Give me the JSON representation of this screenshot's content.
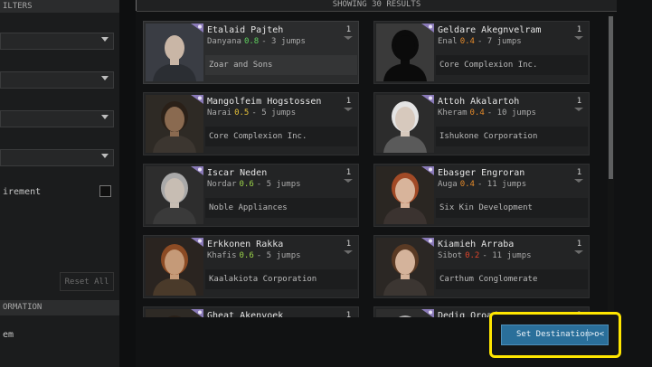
{
  "filters_panel": {
    "header": "ILTERS",
    "dropdown_count": 4,
    "requirement_label": "irement",
    "reset_label": "Reset All",
    "info_header": "ORMATION",
    "info_text": "em"
  },
  "results": {
    "header": "SHOWING 30 RESULTS",
    "agents": [
      {
        "name": "Etalaid Pajteh",
        "system": "Danyana",
        "security": "0.8",
        "security_color": "#5fd35f",
        "jumps": "3 jumps",
        "corporation": "Zoar and Sons",
        "level": "1",
        "portrait": "bald-man",
        "selected": true
      },
      {
        "name": "Geldare Akegnvelram",
        "system": "Enal",
        "security": "0.4",
        "security_color": "#e58a2a",
        "jumps": "7 jumps",
        "corporation": "Core Complexion Inc.",
        "level": "1",
        "portrait": "silhouette"
      },
      {
        "name": "Mangolfeim Hogstossen",
        "system": "Narai",
        "security": "0.5",
        "security_color": "#e6c13a",
        "jumps": "5 jumps",
        "corporation": "Core Complexion Inc.",
        "level": "1",
        "portrait": "man-dark"
      },
      {
        "name": "Attoh Akalartoh",
        "system": "Kheram",
        "security": "0.4",
        "security_color": "#e58a2a",
        "jumps": "10 jumps",
        "corporation": "Ishukone Corporation",
        "level": "1",
        "portrait": "woman-white-hair"
      },
      {
        "name": "Iscar Neden",
        "system": "Nordar",
        "security": "0.6",
        "security_color": "#9bd34a",
        "jumps": "5 jumps",
        "corporation": "Noble Appliances",
        "level": "1",
        "portrait": "man-pale"
      },
      {
        "name": "Ebasger Engroran",
        "system": "Auga",
        "security": "0.4",
        "security_color": "#e58a2a",
        "jumps": "11 jumps",
        "corporation": "Six Kin Development",
        "level": "1",
        "portrait": "woman-red-hair"
      },
      {
        "name": "Erkkonen Rakka",
        "system": "Khafis",
        "security": "0.6",
        "security_color": "#9bd34a",
        "jumps": "5 jumps",
        "corporation": "Kaalakiota Corporation",
        "level": "1",
        "portrait": "man-redhead"
      },
      {
        "name": "Kiamieh Arraba",
        "system": "Sibot",
        "security": "0.2",
        "security_color": "#e0452c",
        "jumps": "11 jumps",
        "corporation": "Carthum Conglomerate",
        "level": "1",
        "portrait": "woman-brown-hair"
      },
      {
        "name": "Gheat Akenvoek",
        "system": "",
        "security": "",
        "security_color": "#888888",
        "jumps": "",
        "corporation": "",
        "level": "1",
        "portrait": "man-dark"
      },
      {
        "name": "Dedig Oroadx",
        "system": "",
        "security": "",
        "security_color": "#888888",
        "jumps": "",
        "corporation": "",
        "level": "1",
        "portrait": "man-pale"
      }
    ]
  },
  "set_destination": {
    "label": "Set Destination",
    "icon_text": ">o<",
    "accent": "#2a6f9a",
    "highlight": "#ffe600"
  }
}
